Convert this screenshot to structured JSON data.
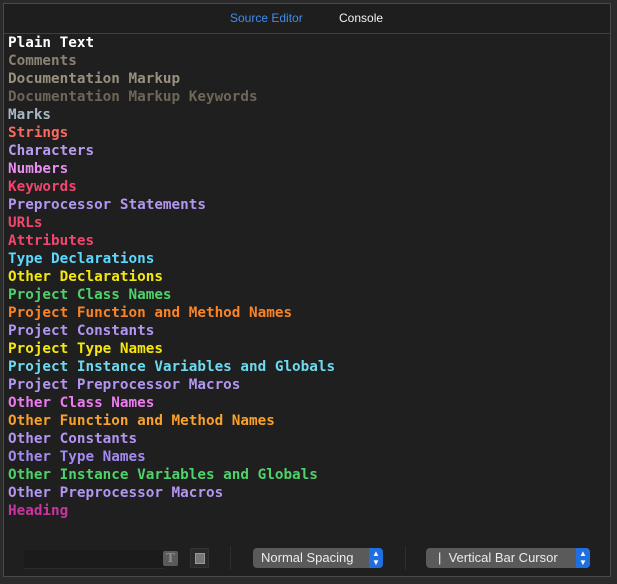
{
  "tabs": {
    "source_editor": "Source Editor",
    "console": "Console"
  },
  "colors": {
    "accent": "#3d8ef2"
  },
  "items": [
    {
      "label": "Plain Text",
      "color": "#ffffff"
    },
    {
      "label": "Comments",
      "color": "#8c8373"
    },
    {
      "label": "Documentation Markup",
      "color": "#9a907e"
    },
    {
      "label": "Documentation Markup Keywords",
      "color": "#6e6658"
    },
    {
      "label": "Marks",
      "color": "#a9b6c4"
    },
    {
      "label": "Strings",
      "color": "#fc6a5d"
    },
    {
      "label": "Characters",
      "color": "#b99cf0"
    },
    {
      "label": "Numbers",
      "color": "#e98ff0"
    },
    {
      "label": "Keywords",
      "color": "#f2456f"
    },
    {
      "label": "Preprocessor Statements",
      "color": "#b395f2"
    },
    {
      "label": "URLs",
      "color": "#f2456f"
    },
    {
      "label": "Attributes",
      "color": "#f2456f"
    },
    {
      "label": "Type Declarations",
      "color": "#5dd8ff"
    },
    {
      "label": "Other Declarations",
      "color": "#f5e80f"
    },
    {
      "label": "Project Class Names",
      "color": "#4ed26a"
    },
    {
      "label": "Project Function and Method Names",
      "color": "#f98427"
    },
    {
      "label": "Project Constants",
      "color": "#b395f2"
    },
    {
      "label": "Project Type Names",
      "color": "#f5e80f"
    },
    {
      "label": "Project Instance Variables and Globals",
      "color": "#6ddaf0"
    },
    {
      "label": "Project Preprocessor Macros",
      "color": "#b395f2"
    },
    {
      "label": "Other Class Names",
      "color": "#ec7cf0"
    },
    {
      "label": "Other Function and Method Names",
      "color": "#f9a12a"
    },
    {
      "label": "Other Constants",
      "color": "#b395f2"
    },
    {
      "label": "Other Type Names",
      "color": "#a48af2"
    },
    {
      "label": "Other Instance Variables and Globals",
      "color": "#4ed26a"
    },
    {
      "label": "Other Preprocessor Macros",
      "color": "#b395f2"
    },
    {
      "label": "Heading",
      "color": "#c9359e"
    }
  ],
  "bottom": {
    "font_icon": "T",
    "spacing": "Normal Spacing",
    "cursor": "|  Vertical Bar Cursor"
  }
}
